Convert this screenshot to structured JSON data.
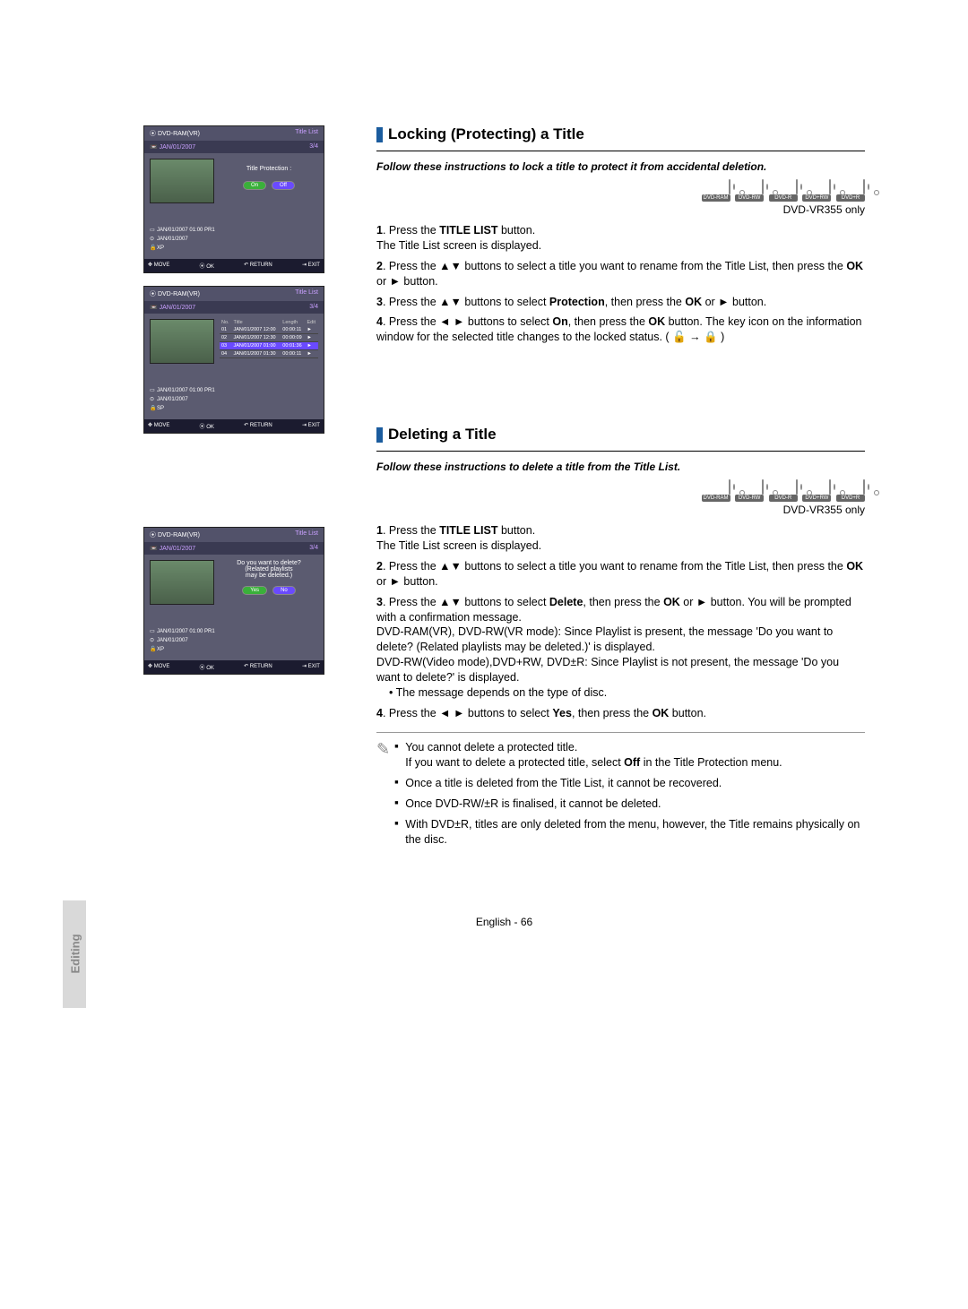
{
  "sideTab": "Editing",
  "footer": "English - 66",
  "section1": {
    "title": "Locking (Protecting) a Title",
    "intro": "Follow these instructions to lock a title to protect it from accidental deletion.",
    "discs": [
      "DVD-RAM",
      "DVD-RW",
      "DVD-R",
      "DVD+RW",
      "DVD+R"
    ],
    "model": "DVD-VR355 only",
    "step1a": "1",
    "step1b": ". Press the ",
    "step1c": "TITLE LIST",
    "step1d": " button.",
    "step1e": "The Title List screen is displayed.",
    "step2a": "2",
    "step2b": ". Press the ▲▼ buttons to select a title you want to rename from the Title List, then press the ",
    "step2c": "OK",
    "step2d": " or ► button.",
    "step3a": "3",
    "step3b": ". Press the ▲▼ buttons to select ",
    "step3c": "Protection",
    "step3d": ", then press the ",
    "step3e": "OK",
    "step3f": " or ► button.",
    "step4a": "4",
    "step4b": ". Press the ◄ ► buttons to select ",
    "step4c": "On",
    "step4d": ", then press the ",
    "step4e": "OK",
    "step4f": " button. The key icon on the information window for the selected title changes to the locked status. ( 🔓 → 🔒 )"
  },
  "section2": {
    "title": "Deleting a Title",
    "intro": "Follow these instructions to delete a title from the Title List.",
    "discs": [
      "DVD-RAM",
      "DVD-RW",
      "DVD-R",
      "DVD+RW",
      "DVD+R"
    ],
    "model": "DVD-VR355 only",
    "step1a": "1",
    "step1b": ". Press the ",
    "step1c": "TITLE LIST",
    "step1d": " button.",
    "step1e": "The Title List screen is displayed.",
    "step2a": "2",
    "step2b": ". Press the ▲▼ buttons to select a title you want to rename from the Title List, then press the ",
    "step2c": "OK",
    "step2d": " or ► button.",
    "step3a": "3",
    "step3b": ". Press the ▲▼ buttons to select ",
    "step3c": "Delete",
    "step3d": ", then press the ",
    "step3e": "OK",
    "step3f": " or ► button. You will be prompted with a confirmation message.",
    "step3g": "DVD-RAM(VR), DVD-RW(VR mode): Since Playlist is present, the message 'Do you want to delete? (Related playlists may be deleted.)' is displayed.",
    "step3h": "DVD-RW(Video mode),DVD+RW, DVD±R: Since Playlist is not present, the message 'Do you want to delete?' is displayed.",
    "step3bullet": "The message depends on the type of disc.",
    "step4a": "4",
    "step4b": ". Press the ◄ ► buttons to select ",
    "step4c": "Yes",
    "step4d": ", then press the ",
    "step4e": "OK",
    "step4f": " button.",
    "notes": {
      "n1a": "You cannot delete a protected title.",
      "n1b": "If you want to delete a protected title, select ",
      "n1c": "Off",
      "n1d": " in the Title Protection menu.",
      "n2": "Once a title is deleted from the Title List, it cannot be recovered.",
      "n3": "Once DVD-RW/±R is finalised, it cannot be deleted.",
      "n4": "With DVD±R, titles are only deleted from the menu, however, the Title remains physically on the disc."
    }
  },
  "osd": {
    "disc": "DVD-RAM(VR)",
    "titleList": "Title List",
    "date": "JAN/01/2007",
    "page": "3/4",
    "info1": "JAN/01/2007 01:00 PR1",
    "info2": "JAN/01/2007",
    "info3": "XP",
    "info3b": "SP",
    "protLabel": "Title Protection :",
    "on": "On",
    "off": "Off",
    "move": "MOVE",
    "ok": "OK",
    "return": "RETURN",
    "exit": "EXIT",
    "colNo": "No.",
    "colTitle": "Title",
    "colLength": "Length",
    "colEdit": "Edit",
    "rows": [
      {
        "no": "01",
        "title": "JAN/01/2007 12:00",
        "len": "00:00:11",
        "edit": "►"
      },
      {
        "no": "02",
        "title": "JAN/01/2007 12:30",
        "len": "00:00:09",
        "edit": "►"
      },
      {
        "no": "03",
        "title": "JAN/01/2007 01:00",
        "len": "00:01:36",
        "edit": "►"
      },
      {
        "no": "04",
        "title": "JAN/01/2007 01:30",
        "len": "00:00:11",
        "edit": "►"
      }
    ],
    "delQ1": "Do you want to delete?",
    "delQ2": "(Related playlists",
    "delQ3": "may be deleted.)",
    "yes": "Yes",
    "no2": "No"
  }
}
